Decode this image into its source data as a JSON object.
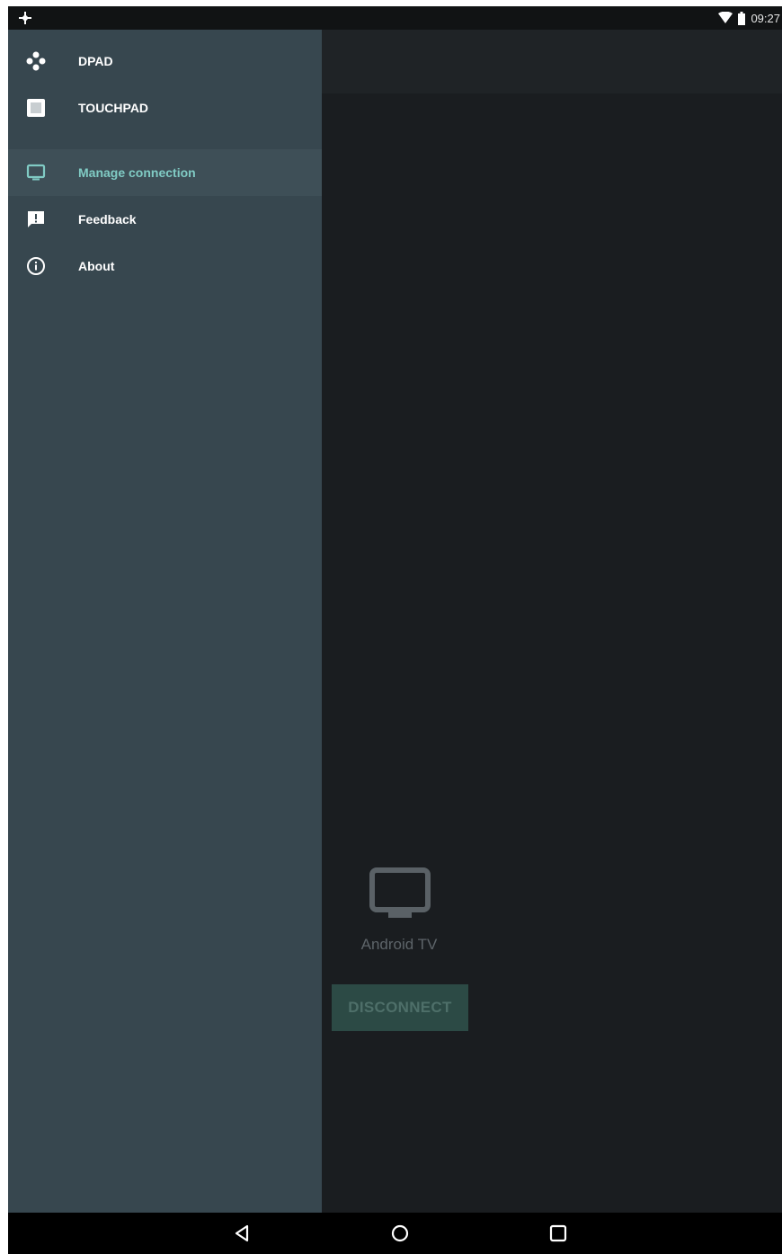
{
  "status_bar": {
    "time": "09:27",
    "icons": [
      "app-notification-icon",
      "wifi-icon",
      "battery-icon"
    ]
  },
  "drawer": {
    "sections": [
      {
        "items": [
          {
            "icon": "dpad-icon",
            "label": "DPAD",
            "active": false
          },
          {
            "icon": "touchpad-icon",
            "label": "TOUCHPAD",
            "active": false
          }
        ]
      },
      {
        "items": [
          {
            "icon": "tv-icon",
            "label": "Manage connection",
            "active": true
          },
          {
            "icon": "feedback-icon",
            "label": "Feedback",
            "active": false
          },
          {
            "icon": "info-icon",
            "label": "About",
            "active": false
          }
        ]
      }
    ]
  },
  "main": {
    "device_icon": "tv-icon",
    "device_name": "Android TV",
    "disconnect_label": "DISCONNECT"
  },
  "nav_bar": {
    "buttons": [
      "back-icon",
      "home-icon",
      "recents-icon"
    ]
  },
  "colors": {
    "drawer_bg": "#37474f",
    "accent": "#80cbc4",
    "content_bg": "#1a1d20",
    "button_bg": "#2c4a45"
  }
}
